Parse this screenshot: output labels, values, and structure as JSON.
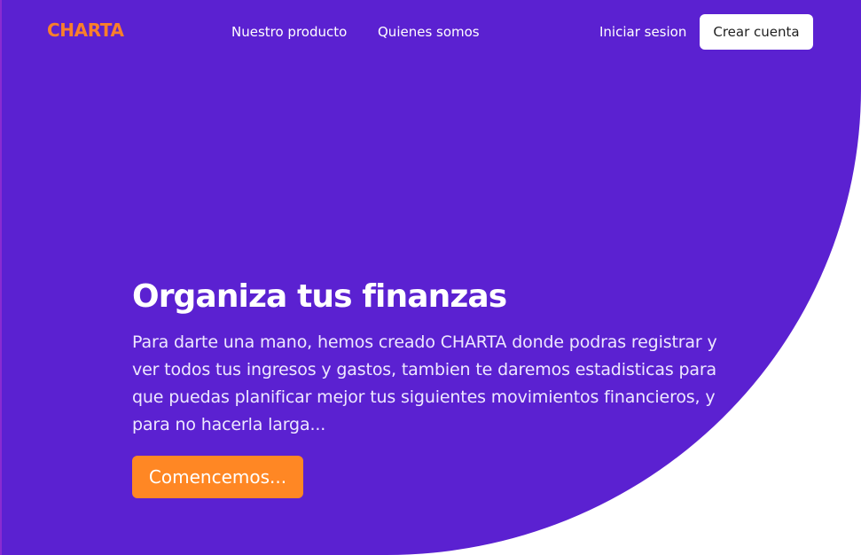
{
  "brand": {
    "name": "CHARTA",
    "colors": {
      "primary": "#5b21d1",
      "accent": "#ff8724",
      "logo": "#f97f2b",
      "background": "#ffffff",
      "text_on_primary": "#ffffff"
    }
  },
  "nav": {
    "links": [
      {
        "label": "Nuestro producto"
      },
      {
        "label": "Quienes somos"
      }
    ],
    "login_label": "Iniciar sesion",
    "signup_label": "Crear cuenta"
  },
  "hero": {
    "title": "Organiza tus finanzas",
    "description": "Para darte una mano, hemos creado CHARTA donde podras registrar y ver todos tus ingresos y gastos, tambien te daremos estadisticas para que puedas planificar mejor tus siguientes movimientos financieros, y para no hacerla larga...",
    "cta_label": "Comencemos..."
  }
}
